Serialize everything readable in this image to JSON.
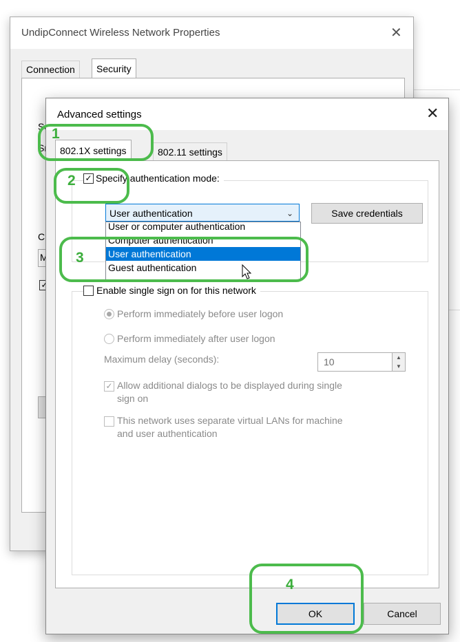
{
  "back_window": {
    "title": "UndipConnect Wireless Network Properties",
    "tabs": [
      "Connection",
      "Security"
    ],
    "close_glyph": "✕",
    "partial": {
      "s1": "Se",
      "s2": "Sn",
      "ch": "Ch",
      "m": "M"
    }
  },
  "dialog": {
    "title": "Advanced settings",
    "close_glyph": "✕",
    "tabs": {
      "active": "802.1X settings",
      "inactive": "802.11 settings"
    },
    "auth_group": {
      "checkbox_label": "Specify authentication mode:",
      "checked": true,
      "select_value": "User authentication",
      "save_credentials_label": "Save credentials",
      "options": [
        "User or computer authentication",
        "Computer authentication",
        "User authentication",
        "Guest authentication"
      ],
      "selected_index": 2
    },
    "sso_group": {
      "checkbox_label": "Enable single sign on for this network",
      "radio1": "Perform immediately before user logon",
      "radio2": "Perform immediately after user logon",
      "delay_label": "Maximum delay (seconds):",
      "delay_value": "10",
      "allow_dialogs_label_l1": "Allow additional dialogs to be displayed during single",
      "allow_dialogs_label_l2": "sign on",
      "vlan_label_l1": "This network uses separate virtual LANs for machine",
      "vlan_label_l2": "and user authentication"
    },
    "ok_label": "OK",
    "cancel_label": "Cancel"
  },
  "annotations": [
    "1",
    "2",
    "3",
    "4"
  ],
  "colors": {
    "accent": "#0078d7",
    "annotation": "#4cbb4c"
  }
}
